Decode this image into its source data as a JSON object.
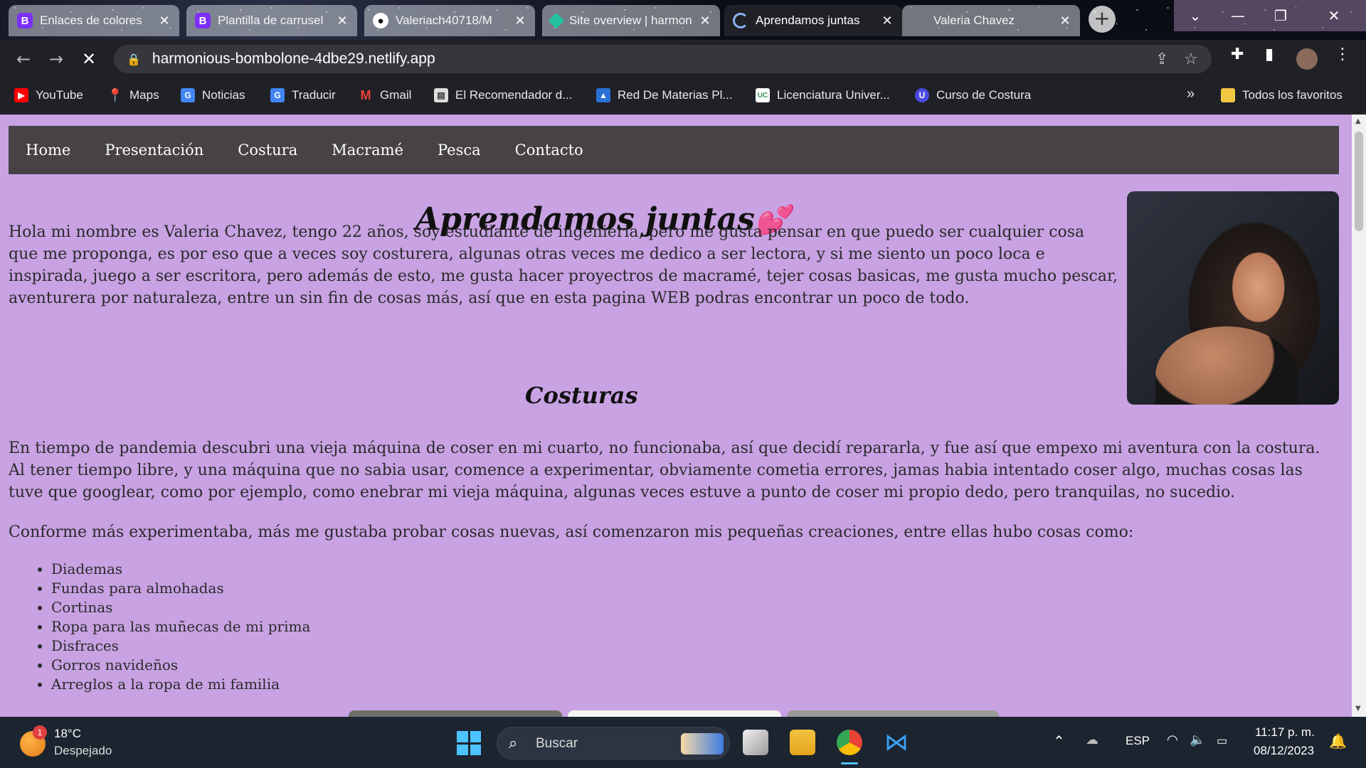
{
  "tabs": [
    {
      "title": "Enlaces de colores",
      "favicon": "B",
      "favicon_color": "#7b2ff7",
      "active": false
    },
    {
      "title": "Plantilla de carrusel",
      "favicon": "B",
      "favicon_color": "#7b2ff7",
      "active": false
    },
    {
      "title": "Valeriach40718/M",
      "favicon": "github-icon",
      "favicon_color": "#1f2127",
      "active": false
    },
    {
      "title": "Site overview | harmonious",
      "favicon": "netlify-icon",
      "favicon_color": "#25c2a0",
      "active": false
    },
    {
      "title": "Aprendamos juntas",
      "favicon": "loading-icon",
      "favicon_color": "#8ab4f8",
      "active": true
    },
    {
      "title": "Valeria Chavez",
      "favicon": "",
      "favicon_color": "#888",
      "active": false
    }
  ],
  "browser": {
    "url": "harmonious-bombolone-4dbe29.netlify.app"
  },
  "bookmarks": [
    {
      "label": "YouTube",
      "icon": "youtube-icon",
      "color": "#ff0000"
    },
    {
      "label": "Maps",
      "icon": "maps-icon",
      "color": "#34a853"
    },
    {
      "label": "Noticias",
      "icon": "news-icon",
      "color": "#4285f4"
    },
    {
      "label": "Traducir",
      "icon": "translate-icon",
      "color": "#4285f4"
    },
    {
      "label": "Gmail",
      "icon": "gmail-icon",
      "color": "#ea4335"
    },
    {
      "label": "El Recomendador d...",
      "icon": "page-icon",
      "color": "#dddddd"
    },
    {
      "label": "Red De Materias Pl...",
      "icon": "page-icon",
      "color": "#2a6fd6"
    },
    {
      "label": "Licenciatura Univer...",
      "icon": "uc-icon",
      "color": "#2f8f4e"
    },
    {
      "label": "Curso de Costura",
      "icon": "u-icon",
      "color": "#4a4adf"
    }
  ],
  "bookmarks_more": "»",
  "bookmarks_all": "Todos los favoritos",
  "site": {
    "nav": [
      "Home",
      "Presentación",
      "Costura",
      "Macramé",
      "Pesca",
      "Contacto"
    ],
    "title": "Aprendamos juntas",
    "title_emoji": "💕",
    "intro": "Hola mi nombre es Valeria Chavez, tengo 22 años, soy estudiante de ingenieria, pero me gusta pensar en que puedo ser cualquier cosa que me proponga, es por eso que a veces soy costurera, algunas otras veces me dedico a ser lectora, y si me siento un poco loca e inspirada, juego a ser escritora, pero además de esto, me gusta hacer proyectros de macramé, tejer cosas basicas, me gusta mucho pescar, aventurera por naturaleza, entre un sin fin de cosas más, así que en esta pagina WEB podras encontrar un poco de todo.",
    "section_title": "Costuras",
    "para1": "En tiempo de pandemia descubri una vieja máquina de coser en mi cuarto, no funcionaba, así que decidí repararla, y fue así que empexo mi aventura con la costura. Al tener tiempo libre, y una máquina que no sabia usar, comence a experimentar, obviamente cometia errores, jamas habia intentado coser algo, muchas cosas las tuve que googlear, como por ejemplo, como enebrar mi vieja máquina, algunas veces estuve a punto de coser mi propio dedo, pero tranquilas, no sucedio.",
    "para2": "Conforme más experimentaba, más me gustaba probar cosas nuevas, así comenzaron mis pequeñas creaciones, entre ellas hubo cosas como:",
    "items": [
      "Diademas",
      "Fundas para almohadas",
      "Cortinas",
      "Ropa para las muñecas de mi prima",
      "Disfraces",
      "Gorros navideños",
      "Arreglos a la ropa de mi familia"
    ],
    "bg_color": "#c8a2e3",
    "nav_color": "#464246"
  },
  "taskbar": {
    "weather_temp": "18°C",
    "weather_desc": "Despejado",
    "weather_badge": "1",
    "search_placeholder": "Buscar",
    "language": "ESP",
    "time": "11:17 p. m.",
    "date": "08/12/2023"
  }
}
